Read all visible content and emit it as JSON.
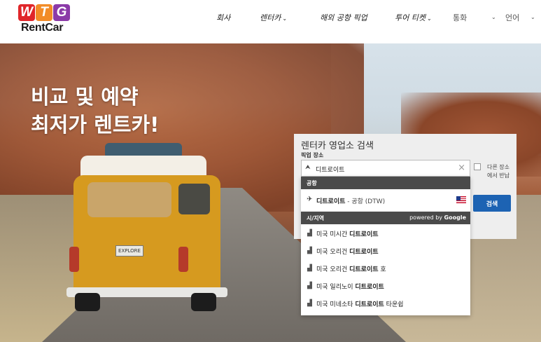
{
  "brand": {
    "logo_letters": [
      "W",
      "T",
      "G"
    ],
    "logo_colors": [
      "#e0262a",
      "#f28c28",
      "#8b3aa8"
    ],
    "name": "RentCar"
  },
  "nav": {
    "company": "회사",
    "rentcar": "렌터카",
    "overseas_pickup": "해외 공항 픽업",
    "tour_ticket": "투어 티켓",
    "currency": "통화",
    "language": "언어"
  },
  "hero": {
    "line1": "비교 및 예약",
    "line2": "최저가 렌트카!",
    "van_plate": "EXPLORE"
  },
  "search": {
    "title": "렌터카 영업소 검색",
    "pickup_label": "픽업 장소",
    "input_value": "디트로이트",
    "other_location_line1": "다른 장소",
    "other_location_line2": "에서 반납",
    "search_button": "검색"
  },
  "dropdown": {
    "airport_header": "공항",
    "airport": {
      "name": "디트로이트",
      "suffix": " - 공항 (DTW)"
    },
    "city_header": "시/지역",
    "powered_prefix": "powered by ",
    "powered_brand": "Google",
    "cities": [
      {
        "prefix": "미국 미시간 ",
        "match": "디트로이트",
        "suffix": ""
      },
      {
        "prefix": "미국 오리건 ",
        "match": "디트로이트",
        "suffix": ""
      },
      {
        "prefix": "미국 오리건 ",
        "match": "디트로이트",
        "suffix": " 호"
      },
      {
        "prefix": "미국 일리노이 ",
        "match": "디트로이트",
        "suffix": ""
      },
      {
        "prefix": "미국 미네소타 ",
        "match": "디트로이트",
        "suffix": " 타운쉽"
      }
    ]
  },
  "icons": {
    "caret": "⌄",
    "clear": "×",
    "input_icon": "⮝",
    "plane": "✈",
    "city": "▟"
  }
}
